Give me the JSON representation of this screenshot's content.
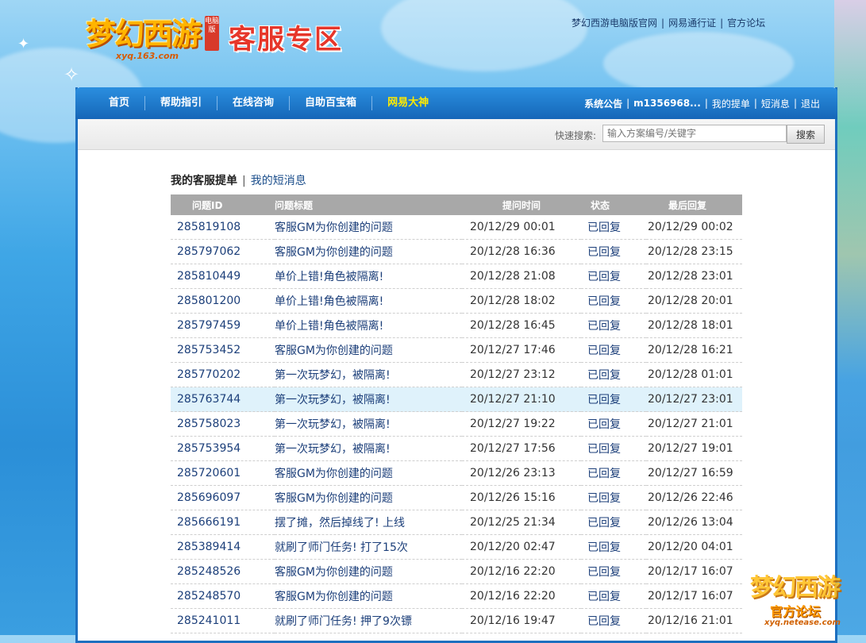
{
  "header": {
    "logo_game": "梦幻西游",
    "logo_badge": "电脑版",
    "logo_url": "xyq.163.com",
    "logo_title": "客服专区",
    "top_links": [
      "梦幻西游电脑版官网",
      "网易通行证",
      "官方论坛"
    ]
  },
  "nav": {
    "items": [
      "首页",
      "帮助指引",
      "在线咨询",
      "自助百宝箱",
      "网易大神"
    ],
    "right": {
      "announcement": "系统公告",
      "user": "m1356968...",
      "my_tickets": "我的提单",
      "messages": "短消息",
      "logout": "退出"
    }
  },
  "search": {
    "label": "快速搜索:",
    "placeholder": "输入方案编号/关键字",
    "button": "搜索"
  },
  "subtabs": {
    "active": "我的客服提单",
    "other": "我的短消息"
  },
  "table": {
    "headers": [
      "问题ID",
      "问题标题",
      "提问时间",
      "状态",
      "最后回复"
    ],
    "rows": [
      {
        "id": "285819108",
        "title": "客服GM为你创建的问题",
        "asked": "20/12/29 00:01",
        "status": "已回复",
        "last": "20/12/29 00:02"
      },
      {
        "id": "285797062",
        "title": "客服GM为你创建的问题",
        "asked": "20/12/28 16:36",
        "status": "已回复",
        "last": "20/12/28 23:15"
      },
      {
        "id": "285810449",
        "title": "单价上错!角色被隔离!",
        "asked": "20/12/28 21:08",
        "status": "已回复",
        "last": "20/12/28 23:01"
      },
      {
        "id": "285801200",
        "title": "单价上错!角色被隔离!",
        "asked": "20/12/28 18:02",
        "status": "已回复",
        "last": "20/12/28 20:01"
      },
      {
        "id": "285797459",
        "title": "单价上错!角色被隔离!",
        "asked": "20/12/28 16:45",
        "status": "已回复",
        "last": "20/12/28 18:01"
      },
      {
        "id": "285753452",
        "title": "客服GM为你创建的问题",
        "asked": "20/12/27 17:46",
        "status": "已回复",
        "last": "20/12/28 16:21"
      },
      {
        "id": "285770202",
        "title": "第一次玩梦幻，被隔离!",
        "asked": "20/12/27 23:12",
        "status": "已回复",
        "last": "20/12/28 01:01"
      },
      {
        "id": "285763744",
        "title": "第一次玩梦幻，被隔离!",
        "asked": "20/12/27 21:10",
        "status": "已回复",
        "last": "20/12/27 23:01"
      },
      {
        "id": "285758023",
        "title": "第一次玩梦幻，被隔离!",
        "asked": "20/12/27 19:22",
        "status": "已回复",
        "last": "20/12/27 21:01"
      },
      {
        "id": "285753954",
        "title": "第一次玩梦幻，被隔离!",
        "asked": "20/12/27 17:56",
        "status": "已回复",
        "last": "20/12/27 19:01"
      },
      {
        "id": "285720601",
        "title": "客服GM为你创建的问题",
        "asked": "20/12/26 23:13",
        "status": "已回复",
        "last": "20/12/27 16:59"
      },
      {
        "id": "285696097",
        "title": "客服GM为你创建的问题",
        "asked": "20/12/26 15:16",
        "status": "已回复",
        "last": "20/12/26 22:46"
      },
      {
        "id": "285666191",
        "title": "摆了摊，然后掉线了! 上线",
        "asked": "20/12/25 21:34",
        "status": "已回复",
        "last": "20/12/26 13:04"
      },
      {
        "id": "285389414",
        "title": "就刷了师门任务! 打了15次",
        "asked": "20/12/20 02:47",
        "status": "已回复",
        "last": "20/12/20 04:01"
      },
      {
        "id": "285248526",
        "title": "客服GM为你创建的问题",
        "asked": "20/12/16 22:20",
        "status": "已回复",
        "last": "20/12/17 16:07"
      },
      {
        "id": "285248570",
        "title": "客服GM为你创建的问题",
        "asked": "20/12/16 22:20",
        "status": "已回复",
        "last": "20/12/17 16:07"
      },
      {
        "id": "285241011",
        "title": "就刷了师门任务! 押了9次镖",
        "asked": "20/12/16 19:47",
        "status": "已回复",
        "last": "20/12/16 21:01"
      }
    ],
    "highlight_index": 7
  },
  "watermark": {
    "game": "梦幻西游",
    "sub": "官方论坛",
    "url": "xyq.netease.com"
  },
  "colors": {
    "nav_bg": "#1566b8",
    "nav_highlight": "#ffea00",
    "link": "#1c3f7a",
    "header_gray": "#a8a8a8",
    "row_highlight": "#dff2fb"
  }
}
